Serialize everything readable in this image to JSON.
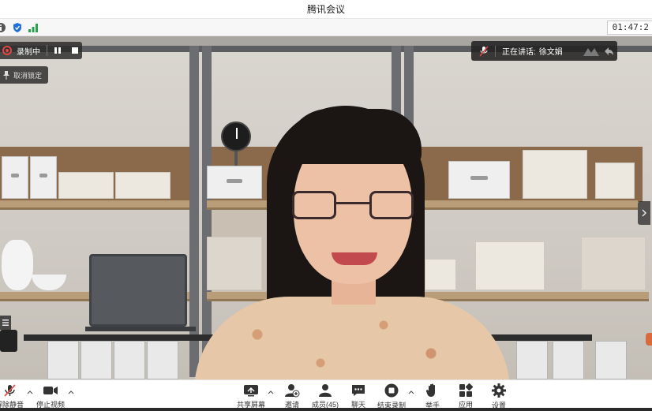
{
  "window": {
    "title": "腾讯会议"
  },
  "status": {
    "icons": [
      "info-icon",
      "shield-icon",
      "signal-icon"
    ],
    "timer": "01:47:2"
  },
  "recording": {
    "label": "录制中",
    "pause_icon": "pause-icon",
    "stop_icon": "stop-icon"
  },
  "pin": {
    "label": "取消锁定"
  },
  "speaker": {
    "prefix": "正在讲话:",
    "name": "徐文娟"
  },
  "toolbar": {
    "items": [
      {
        "name": "unmute",
        "label": "解除静音",
        "icon": "mic-muted-icon"
      },
      {
        "name": "stop-video",
        "label": "停止视频",
        "icon": "camera-icon"
      },
      {
        "name": "share-screen",
        "label": "共享屏幕",
        "icon": "share-screen-icon"
      },
      {
        "name": "invite",
        "label": "邀请",
        "icon": "invite-icon"
      },
      {
        "name": "members",
        "label": "成员(45)",
        "icon": "members-icon"
      },
      {
        "name": "chat",
        "label": "聊天",
        "icon": "chat-icon"
      },
      {
        "name": "stop-recording",
        "label": "结束录制",
        "icon": "record-stop-icon"
      },
      {
        "name": "raise-hand",
        "label": "举手",
        "icon": "hand-icon"
      },
      {
        "name": "apps",
        "label": "应用",
        "icon": "apps-icon"
      },
      {
        "name": "settings",
        "label": "设置",
        "icon": "gear-icon"
      }
    ]
  },
  "colors": {
    "record_red": "#e54545",
    "toolbar_icon": "#333333",
    "muted_red": "#d9534f",
    "overlay_dark": "#282828"
  }
}
